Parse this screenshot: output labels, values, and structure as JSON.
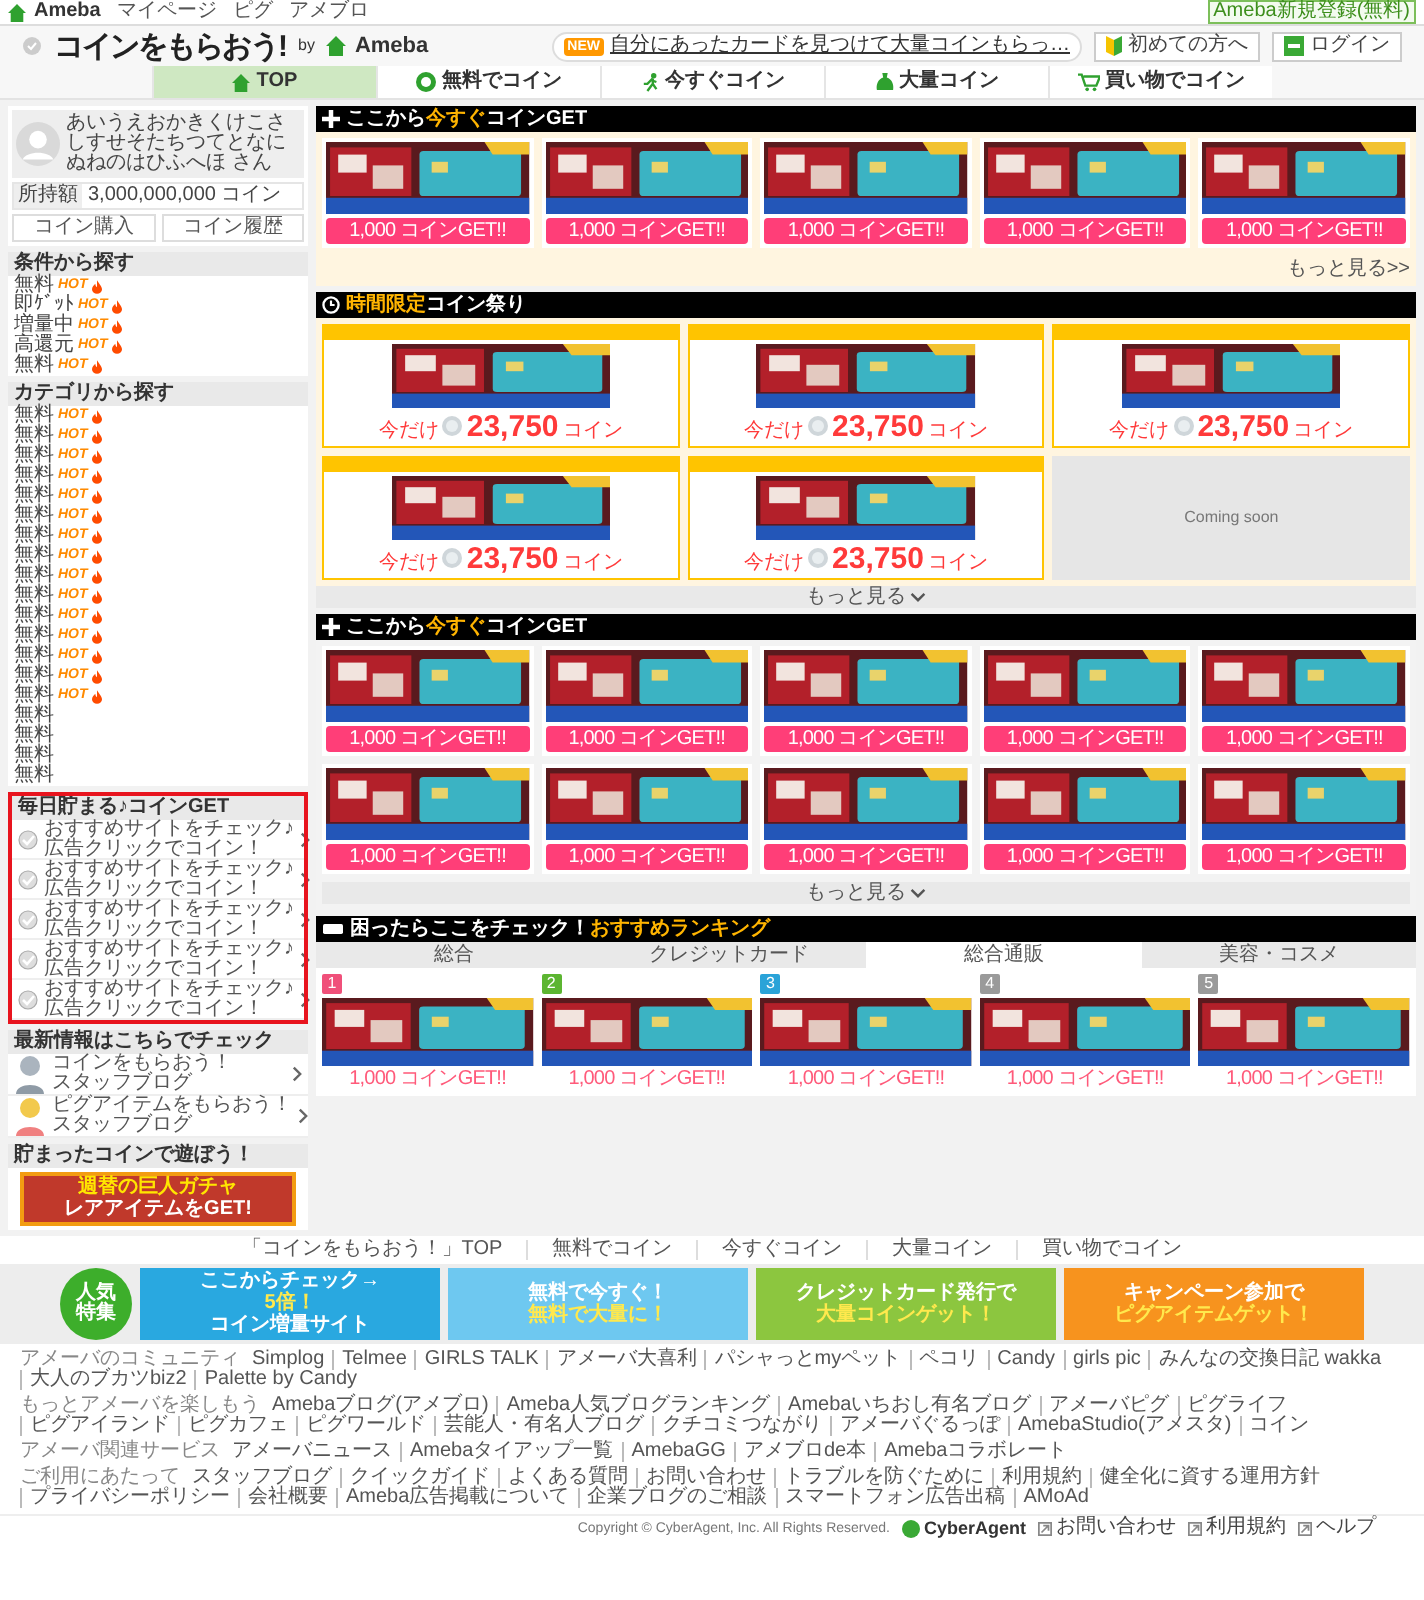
{
  "top_bar": {
    "logo": "Ameba",
    "links": [
      "マイページ",
      "ピグ",
      "アメブロ"
    ],
    "register_button": "Ameba新規登録(無料)"
  },
  "header": {
    "site_title": "コインをもらおう!",
    "by": "by",
    "brand": "Ameba",
    "notice_badge": "NEW",
    "notice": "自分にあったカードを見つけて大量コインもらっ…",
    "buttons": [
      {
        "label": "初めての方へ",
        "kind": "beginner"
      },
      {
        "label": "ログイン",
        "kind": "login"
      }
    ]
  },
  "nav": [
    {
      "label": "TOP",
      "selected": true
    },
    {
      "label": "無料でコイン",
      "selected": false
    },
    {
      "label": "今すぐコイン",
      "selected": false
    },
    {
      "label": "大量コイン",
      "selected": false
    },
    {
      "label": "買い物でコイン",
      "selected": false
    }
  ],
  "profile": {
    "name": "あいうえおかきくけこさしすせそたちつてとなにぬねのはひふへほ さん",
    "balance_label": "所持額",
    "balance": "3,000,000,000 コイン",
    "buttons": [
      "コイン購入",
      "コイン履歴"
    ]
  },
  "sidebar_sections": [
    {
      "title": "条件から探す",
      "kind": "list",
      "items": [
        {
          "label": "無料",
          "badge": "HOT"
        },
        {
          "label": "即ｹﾞｯﾄ",
          "badge": "HOT"
        },
        {
          "label": "増量中",
          "badge": "HOT"
        },
        {
          "label": "高還元",
          "badge": "HOT"
        },
        {
          "label": "無料",
          "badge": "HOT"
        }
      ]
    },
    {
      "title": "カテゴリから探す",
      "kind": "list",
      "items": [
        {
          "label": "無料",
          "badge": "HOT"
        },
        {
          "label": "無料",
          "badge": "HOT"
        },
        {
          "label": "無料",
          "badge": "HOT"
        },
        {
          "label": "無料",
          "badge": "HOT"
        },
        {
          "label": "無料",
          "badge": "HOT"
        },
        {
          "label": "無料",
          "badge": "HOT"
        },
        {
          "label": "無料",
          "badge": "HOT"
        },
        {
          "label": "無料",
          "badge": "HOT"
        },
        {
          "label": "無料",
          "badge": "HOT"
        },
        {
          "label": "無料",
          "badge": "HOT"
        },
        {
          "label": "無料",
          "badge": "HOT"
        },
        {
          "label": "無料",
          "badge": "HOT"
        },
        {
          "label": "無料",
          "badge": "HOT"
        },
        {
          "label": "無料",
          "badge": "HOT"
        },
        {
          "label": "無料",
          "badge": "HOT"
        },
        {
          "label": "無料"
        },
        {
          "label": "無料"
        },
        {
          "label": "無料"
        },
        {
          "label": "無料"
        }
      ]
    },
    {
      "title": "毎日貯まる♪コインGET",
      "kind": "daily",
      "highlighted": true,
      "items": [
        {
          "lines": [
            "おすすめサイトをチェック♪",
            "広告クリックでコイン！"
          ]
        },
        {
          "lines": [
            "おすすめサイトをチェック♪",
            "広告クリックでコイン！"
          ]
        },
        {
          "lines": [
            "おすすめサイトをチェック♪",
            "広告クリックでコイン！"
          ]
        },
        {
          "lines": [
            "おすすめサイトをチェック♪",
            "広告クリックでコイン！"
          ]
        },
        {
          "lines": [
            "おすすめサイトをチェック♪",
            "広告クリックでコイン！"
          ]
        }
      ]
    },
    {
      "title": "最新情報はこちらでチェック",
      "kind": "blog",
      "items": [
        {
          "lines": [
            "コインをもらおう！",
            "スタッフブログ"
          ]
        },
        {
          "lines": [
            "ピグアイテムをもらおう！",
            "スタッフブログ"
          ]
        }
      ]
    },
    {
      "title": "貯まったコインで遊ぼう！",
      "kind": "banner",
      "banner": [
        "週替の巨人ガチャ",
        "レアアイテムをGET!"
      ]
    }
  ],
  "sections": [
    {
      "kind": "cards",
      "title": "ここから**今すぐ**コインGET",
      "more": "もっと見る>>",
      "more_chevron": false,
      "rows": [
        [
          {
            "button": "1,000 コインGET!!"
          },
          {
            "button": "1,000 コインGET!!"
          },
          {
            "button": "1,000 コインGET!!"
          },
          {
            "button": "1,000 コインGET!!"
          },
          {
            "button": "1,000 コインGET!!"
          }
        ]
      ]
    },
    {
      "kind": "timed",
      "title": "**時間限定**コイン祭り",
      "more": "もっと見る",
      "more_chevron": true,
      "placeholder": "Coming soon",
      "cards": [
        {
          "prefix": "今だけ",
          "price": "23,750",
          "unit": "コイン"
        },
        {
          "prefix": "今だけ",
          "price": "23,750",
          "unit": "コイン"
        },
        {
          "prefix": "今だけ",
          "price": "23,750",
          "unit": "コイン"
        },
        {
          "prefix": "今だけ",
          "price": "23,750",
          "unit": "コイン"
        },
        {
          "prefix": "今だけ",
          "price": "23,750",
          "unit": "コイン"
        }
      ]
    },
    {
      "kind": "cards",
      "title": "ここから**今すぐ**コインGET",
      "more": "もっと見る",
      "more_chevron": true,
      "rows": [
        [
          {
            "button": "1,000 コインGET!!"
          },
          {
            "button": "1,000 コインGET!!"
          },
          {
            "button": "1,000 コインGET!!"
          },
          {
            "button": "1,000 コインGET!!"
          },
          {
            "button": "1,000 コインGET!!"
          }
        ],
        [
          {
            "button": "1,000 コインGET!!"
          },
          {
            "button": "1,000 コインGET!!"
          },
          {
            "button": "1,000 コインGET!!"
          },
          {
            "button": "1,000 コインGET!!"
          },
          {
            "button": "1,000 コインGET!!"
          }
        ]
      ]
    },
    {
      "kind": "ranking",
      "title": "困ったらここをチェック！**おすすめランキング**",
      "tabs": [
        {
          "label": "総合",
          "selected": false
        },
        {
          "label": "クレジットカード",
          "selected": false
        },
        {
          "label": "総合通販",
          "selected": true
        },
        {
          "label": "美容・コスメ",
          "selected": false
        }
      ],
      "items": [
        {
          "rank": "1",
          "color": "#f0507a",
          "reward": "1,000 コインGET!!"
        },
        {
          "rank": "2",
          "color": "#5cb531",
          "reward": "1,000 コインGET!!"
        },
        {
          "rank": "3",
          "color": "#2aa3d8",
          "reward": "1,000 コインGET!!"
        },
        {
          "rank": "4",
          "color": "#9a9a9a",
          "reward": "1,000 コインGET!!"
        },
        {
          "rank": "5",
          "color": "#9a9a9a",
          "reward": "1,000 コインGET!!"
        }
      ]
    }
  ],
  "footer_nav": [
    "「コインをもらおう！」TOP",
    "無料でコイン",
    "今すぐコイン",
    "大量コイン",
    "買い物でコイン"
  ],
  "feature": {
    "label": "人気特集",
    "banners": [
      {
        "color": "#29a8e0",
        "lines": [
          "ここからチェック→",
          "5倍！",
          "コイン増量サイト"
        ]
      },
      {
        "color": "#6ec8f0",
        "lines": [
          "無料で今すぐ！",
          "無料で大量に！"
        ]
      },
      {
        "color": "#8cc63f",
        "lines": [
          "クレジットカード発行で",
          "大量コインゲット！"
        ]
      },
      {
        "color": "#f7931e",
        "lines": [
          "キャンペーン参加で",
          "ピグアイテムゲット！"
        ]
      }
    ]
  },
  "footer_groups": [
    {
      "title": "アメーバのコミュニティ",
      "links": [
        "Simplog",
        "Telmee",
        "GIRLS TALK",
        "アメーバ大喜利",
        "パシャっとmyペット",
        "ペコリ",
        "Candy",
        "girls pic",
        "みんなの交換日記 wakka",
        "大人のブカツbiz2",
        "Palette by Candy"
      ]
    },
    {
      "title": "もっとアメーバを楽しもう",
      "links": [
        "Amebaブログ(アメブロ)",
        "Ameba人気ブログランキング",
        "Amebaいちおし有名ブログ",
        "アメーバピグ",
        "ピグライフ",
        "ピグアイランド",
        "ピグカフェ",
        "ピグワールド",
        "芸能人・有名人ブログ",
        "クチコミつながり",
        "アメーバぐるっぽ",
        "AmebaStudio(アメスタ)",
        "コイン"
      ]
    },
    {
      "title": "アメーバ関連サービス",
      "links": [
        "アメーバニュース",
        "Amebaタイアップ一覧",
        "AmebaGG",
        "アメブロde本",
        "Amebaコラボレート"
      ]
    },
    {
      "title": "ご利用にあたって",
      "links": [
        "スタッフブログ",
        "クイックガイド",
        "よくある質問",
        "お問い合わせ",
        "トラブルを防ぐために",
        "利用規約",
        "健全化に資する運用方針",
        "プライバシーポリシー",
        "会社概要",
        "Ameba広告掲載について",
        "企業ブログのご相談",
        "スマートフォン広告出稿",
        "AMoAd"
      ]
    }
  ],
  "copyright": "Copyright © CyberAgent, Inc. All Rights Reserved.",
  "company_logo": "CyberAgent",
  "bottom_links": [
    "お問い合わせ",
    "利用規約",
    "ヘルプ"
  ]
}
